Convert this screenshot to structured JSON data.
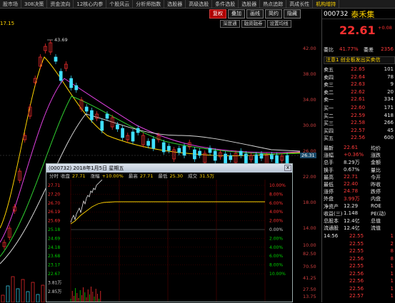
{
  "topnav": {
    "items": [
      "股市场",
      "308决策",
      "资金流向",
      "12核心内参",
      "个股风云",
      "分析师指数",
      "选股器",
      "高级选股",
      "条件选股",
      "选股器",
      "热点追踪",
      "高成长性",
      "机构增持"
    ],
    "hot_index": 12
  },
  "toolbar": {
    "buttons": [
      "复权",
      "叠加",
      "画线",
      "简约",
      "隐藏"
    ],
    "active_index": 0
  },
  "toolbar2": {
    "buttons": [
      "深度通",
      "融资融券",
      "设置均线"
    ]
  },
  "main_chart": {
    "price_tag": "17.15",
    "peak_label": "43.69",
    "axis_labels": [
      "42.00",
      "38.00",
      "34.00",
      "30.00",
      "26.00",
      "22.00",
      "18.00",
      "14.00",
      "10.00",
      "82.50",
      "70.50",
      "41.25",
      "27.50",
      "13.75"
    ],
    "current_price_box": "26.31"
  },
  "stock_panel": {
    "code": "000732",
    "name": "泰禾集",
    "price": "22.61",
    "change_pct": "41.77%",
    "change_amt": "+0.08",
    "banner": "注意1 创业板发出买卖信",
    "ratio_row": {
      "label": "委比",
      "pct": "41.77%",
      "label2": "委差",
      "value": "2356"
    },
    "sells": [
      {
        "label": "卖五",
        "price": "22.65",
        "vol": "101"
      },
      {
        "label": "卖四",
        "price": "22.64",
        "vol": "78"
      },
      {
        "label": "卖三",
        "price": "22.63",
        "vol": "9"
      },
      {
        "label": "卖二",
        "price": "22.62",
        "vol": "20"
      },
      {
        "label": "卖一",
        "price": "22.61",
        "vol": "334"
      }
    ],
    "buys": [
      {
        "label": "买一",
        "price": "22.60",
        "vol": "171"
      },
      {
        "label": "买二",
        "price": "22.59",
        "vol": "418"
      },
      {
        "label": "买三",
        "price": "22.58",
        "vol": "266"
      },
      {
        "label": "买四",
        "price": "22.57",
        "vol": "45"
      },
      {
        "label": "买五",
        "price": "22.56",
        "vol": "600"
      }
    ],
    "stats": [
      {
        "l1": "最新",
        "v1": "22.61",
        "l2": "均价",
        "v2": ""
      },
      {
        "l1": "涨幅",
        "v1": "+0.36%",
        "l2": "涨跌",
        "v2": ""
      },
      {
        "l1": "总手",
        "v1": "8.29万",
        "l2": "金额",
        "v2": ""
      },
      {
        "l1": "换手",
        "v1": "0.67%",
        "l2": "量比",
        "v2": ""
      },
      {
        "l1": "最高",
        "v1": "22.71",
        "l2": "今开",
        "v2": ""
      },
      {
        "l1": "最低",
        "v1": "22.40",
        "l2": "昨收",
        "v2": ""
      },
      {
        "l1": "涨停",
        "v1": "24.78",
        "l2": "跌停",
        "v2": ""
      },
      {
        "l1": "外盘",
        "v1": "3.99万",
        "l2": "内盘",
        "v2": ""
      },
      {
        "l1": "净资产",
        "v1": "12.29",
        "l2": "ROE",
        "v2": ""
      },
      {
        "l1": "收益(三)",
        "v1": "1.148",
        "l2": "PE(动)",
        "v2": ""
      },
      {
        "l1": "总股本",
        "v1": "12.4亿",
        "l2": "总值",
        "v2": ""
      },
      {
        "l1": "流通股",
        "v1": "12.4亿",
        "l2": "流值",
        "v2": ""
      }
    ],
    "ticks": [
      {
        "time": "14:56",
        "price": "22.55",
        "vol": "1"
      },
      {
        "time": "",
        "price": "22.55",
        "vol": "2"
      },
      {
        "time": "",
        "price": "22.55",
        "vol": "8"
      },
      {
        "time": "",
        "price": "22.56",
        "vol": "8"
      },
      {
        "time": "",
        "price": "22.55",
        "vol": "1"
      },
      {
        "time": "",
        "price": "22.56",
        "vol": "1"
      },
      {
        "time": "",
        "price": "22.56",
        "vol": "1"
      },
      {
        "time": "",
        "price": "22.56",
        "vol": "1"
      },
      {
        "time": "",
        "price": "22.57",
        "vol": "1"
      }
    ]
  },
  "popup": {
    "title": "(000732) 2018年1月5日 星期五",
    "close": "x",
    "info": [
      {
        "label": "分时",
        "value": ""
      },
      {
        "label": "收盘",
        "value": "27.71"
      },
      {
        "label": "涨幅",
        "value": "+10.00%"
      },
      {
        "label": "最高",
        "value": "27.71"
      },
      {
        "label": "最低",
        "value": "25.30"
      },
      {
        "label": "成交",
        "value": "31.5万"
      }
    ],
    "left_axis": [
      "27.71",
      "27.20",
      "26.70",
      "26.19",
      "25.69",
      "25.18",
      "24.69",
      "24.18",
      "23.68",
      "23.17",
      "22.67",
      "3.81万",
      "2.85万"
    ],
    "right_axis": [
      "10.00%",
      "8.00%",
      "6.00%",
      "4.00%",
      "2.00%",
      "0.00%",
      "2.00%",
      "4.00%",
      "6.00%",
      "8.00%",
      "10.00%"
    ],
    "colors": {
      "price_line": "#e8e8e8",
      "avg_line": "#ffd400",
      "up": "#ff3030",
      "down": "#00d000"
    }
  }
}
